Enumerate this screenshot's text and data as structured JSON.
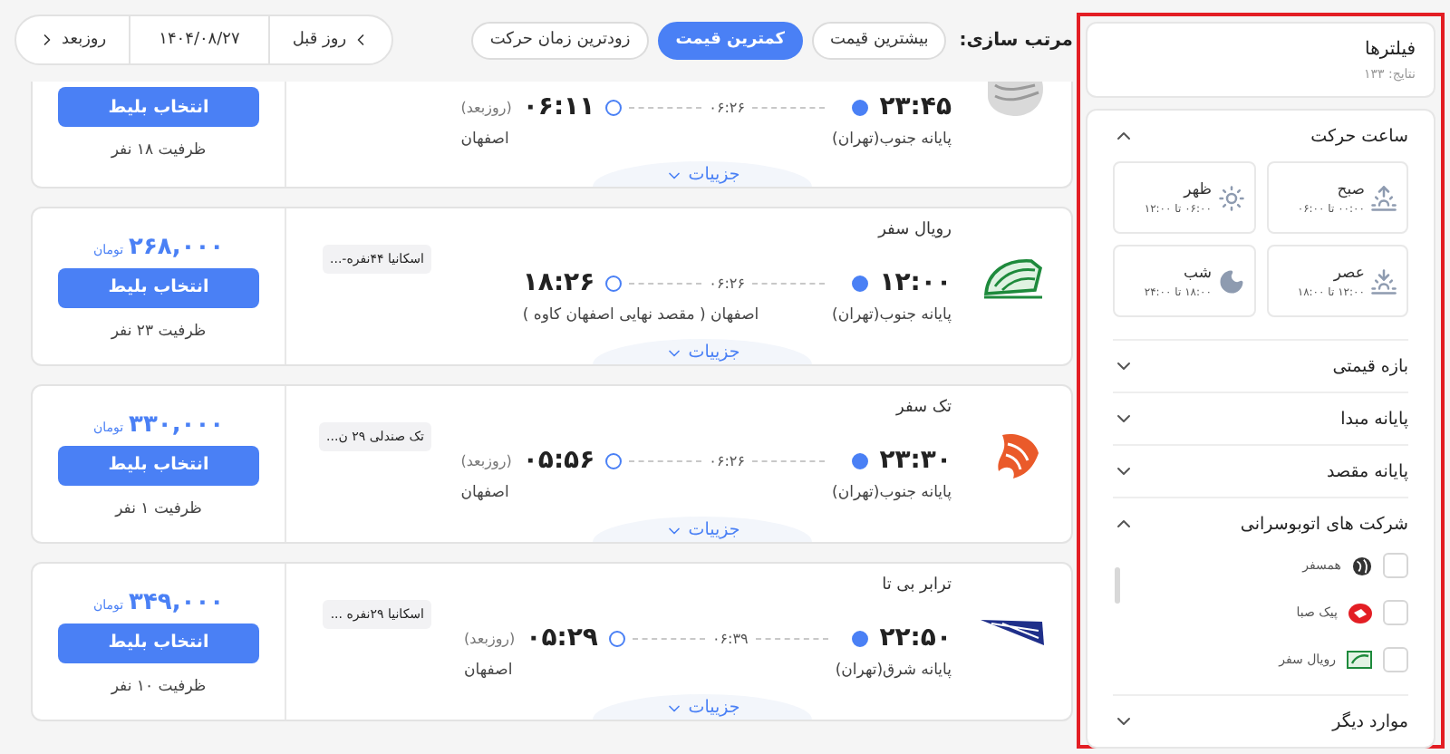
{
  "sort": {
    "label": "مرتب سازی:",
    "options": [
      {
        "label": "بیشترین قیمت",
        "selected": false
      },
      {
        "label": "کمترین قیمت",
        "selected": true
      },
      {
        "label": "زودترین زمان حرکت",
        "selected": false
      }
    ]
  },
  "date_nav": {
    "previous": "روز قبل",
    "date": "۱۴۰۴/۰۸/۲۷",
    "next": "روزبعد"
  },
  "trips": [
    {
      "departure": "۲۳:۴۵",
      "duration": "۰۶:۲۶",
      "arrival": "۰۶:۱۱",
      "arrival_note": "(روزبعد)",
      "origin": "پایانه جنوب(تهران)",
      "destination": "اصفهان",
      "button": "انتخاب بلیط",
      "capacity": "ظرفیت ۱۸ نفر",
      "details": "جزییات"
    },
    {
      "operator": "رویال سفر",
      "departure": "۱۲:۰۰",
      "duration": "۰۶:۲۶",
      "arrival": "۱۸:۲۶",
      "origin": "پایانه جنوب(تهران)",
      "destination": "اصفهان ( مقصد نهایی اصفهان کاوه )",
      "tag": "اسکانیا ۴۴نفره-...",
      "price": "۲۶۸,۰۰۰",
      "currency": "تومان",
      "button": "انتخاب بلیط",
      "capacity": "ظرفیت ۲۳ نفر",
      "details": "جزییات"
    },
    {
      "operator": "تک سفر",
      "departure": "۲۳:۳۰",
      "duration": "۰۶:۲۶",
      "arrival": "۰۵:۵۶",
      "arrival_note": "(روزبعد)",
      "origin": "پایانه جنوب(تهران)",
      "destination": "اصفهان",
      "tag": "تک صندلی ۲۹ ن...",
      "price": "۳۳۰,۰۰۰",
      "currency": "تومان",
      "button": "انتخاب بلیط",
      "capacity": "ظرفیت ۱ نفر",
      "details": "جزییات"
    },
    {
      "operator": "ترابر بی تا",
      "departure": "۲۲:۵۰",
      "duration": "۰۶:۳۹",
      "arrival": "۰۵:۲۹",
      "arrival_note": "(روزبعد)",
      "origin": "پایانه شرق(تهران)",
      "destination": "اصفهان",
      "tag": "اسکانیا ۲۹نفره ...",
      "price": "۳۴۹,۰۰۰",
      "currency": "تومان",
      "button": "انتخاب بلیط",
      "capacity": "ظرفیت ۱۰ نفر",
      "details": "جزییات"
    }
  ],
  "filters": {
    "title": "فیلترها",
    "results": "نتایج: ۱۳۳",
    "sections": [
      {
        "title": "ساعت حرکت",
        "expanded": true,
        "kind": "times",
        "options": [
          {
            "label": "صبح",
            "range": "۰۰:۰۰ تا ۰۶:۰۰"
          },
          {
            "label": "ظهر",
            "range": "۰۶:۰۰ تا ۱۲:۰۰"
          },
          {
            "label": "عصر",
            "range": "۱۲:۰۰ تا ۱۸:۰۰"
          },
          {
            "label": "شب",
            "range": "۱۸:۰۰ تا ۲۴:۰۰"
          }
        ]
      },
      {
        "title": "بازه قیمتی",
        "expanded": false
      },
      {
        "title": "پایانه مبدا",
        "expanded": false
      },
      {
        "title": "پایانه مقصد",
        "expanded": false
      },
      {
        "title": "شرکت های اتوبوسرانی",
        "expanded": true,
        "kind": "companies",
        "options": [
          {
            "label": "همسفر",
            "checked": false
          },
          {
            "label": "پیک صبا",
            "checked": false
          },
          {
            "label": "رویال سفر",
            "checked": false
          }
        ]
      },
      {
        "title": "موارد دیگر",
        "expanded": false
      }
    ]
  }
}
